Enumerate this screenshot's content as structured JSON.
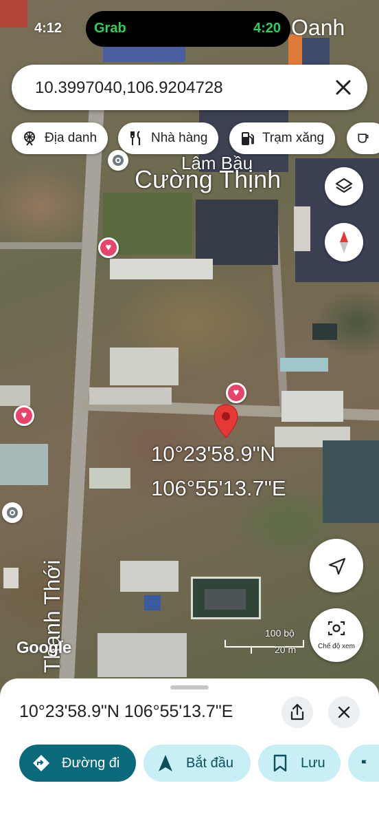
{
  "status_bar": {
    "time": "4:12",
    "right_text": "Oanh"
  },
  "dynamic_island": {
    "app": "Grab",
    "time": "4:20"
  },
  "search": {
    "value": "10.3997040,106.9204728"
  },
  "chips": [
    {
      "label": "Địa danh",
      "icon": "ferris-wheel-icon"
    },
    {
      "label": "Nhà hàng",
      "icon": "fork-knife-icon"
    },
    {
      "label": "Trạm xăng",
      "icon": "gas-station-icon"
    },
    {
      "label": "",
      "icon": "coffee-icon"
    }
  ],
  "map": {
    "place_label": "Cường Thịnh",
    "place_label_partial": "Lâm Bầu",
    "street_label": "Thạnh Thới",
    "pin_coords_line1": "10°23'58.9\"N",
    "pin_coords_line2": "106°55'13.7\"E",
    "scale_top": "100 bộ",
    "scale_bottom": "20 m",
    "street_view_label": "Chế độ xem",
    "attribution": "Google"
  },
  "sheet": {
    "coords": "10°23'58.9\"N 106°55'13.7\"E",
    "actions": [
      {
        "label": "Đường đi",
        "icon": "directions-icon"
      },
      {
        "label": "Bắt đầu",
        "icon": "navigation-arrow-icon"
      },
      {
        "label": "Lưu",
        "icon": "bookmark-icon"
      },
      {
        "label": "",
        "icon": "flag-icon"
      }
    ]
  },
  "colors": {
    "primary": "#0b6a7a",
    "secondary": "#c8eff5",
    "pin": "#e53935",
    "heart": "#e8436b"
  }
}
